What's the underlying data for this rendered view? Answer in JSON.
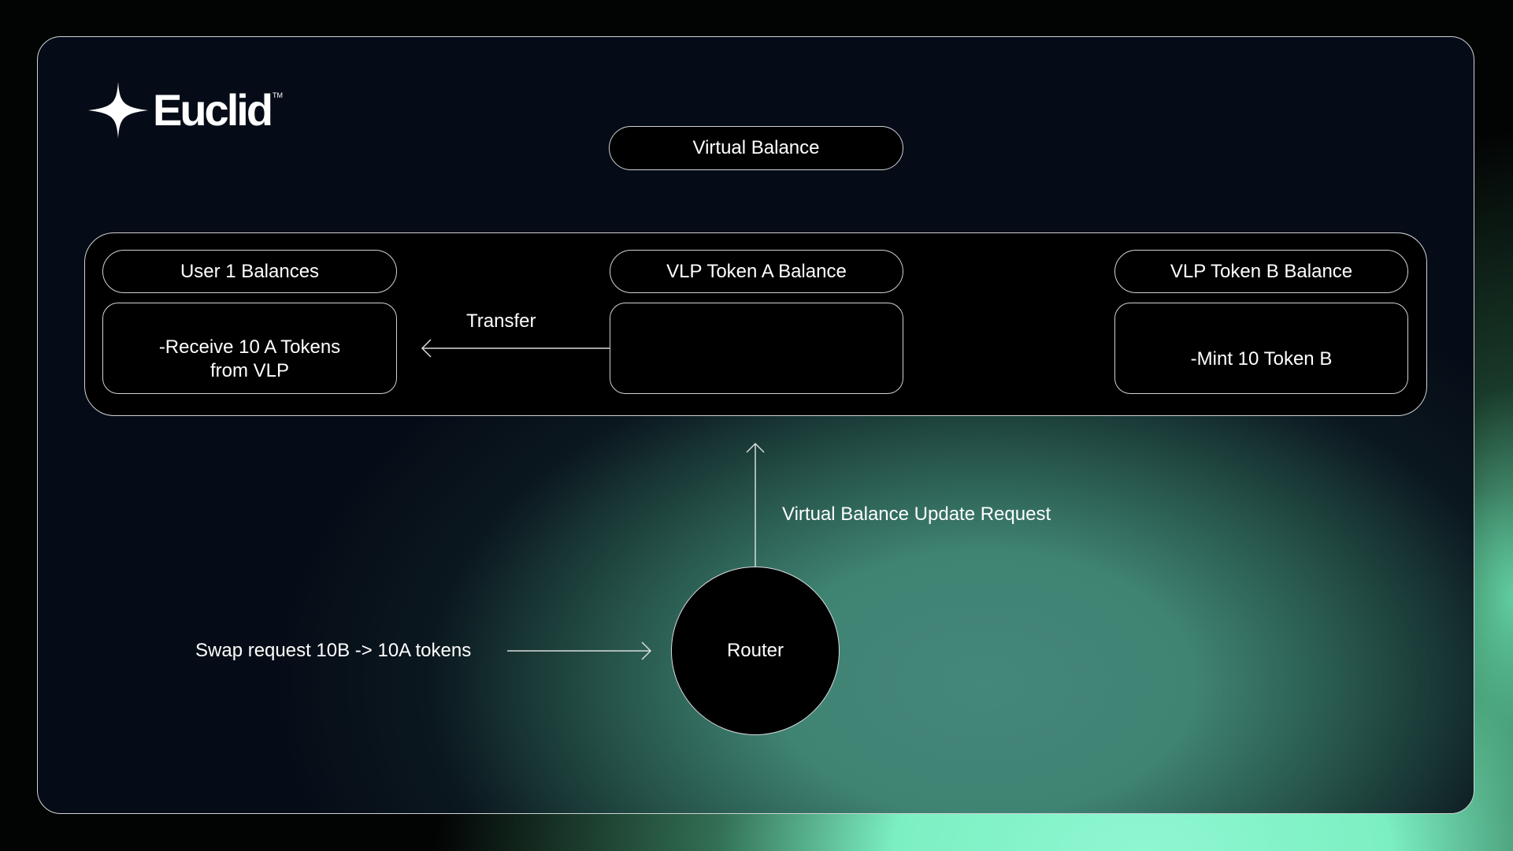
{
  "brand": {
    "name": "Euclid",
    "trademark": "TM",
    "icon": "four-point-star-icon"
  },
  "diagram": {
    "title_pill": "Virtual Balance",
    "columns": [
      {
        "header": "User 1 Balances",
        "body_line1": "-Receive 10 A Tokens",
        "body_line2": "from VLP"
      },
      {
        "header": "VLP Token A Balance",
        "body_line1": "",
        "body_line2": ""
      },
      {
        "header": "VLP Token B Balance",
        "body_line1": "-Mint 10 Token B",
        "body_line2": ""
      }
    ],
    "transfer_label": "Transfer",
    "update_request_label": "Virtual Balance Update Request",
    "router_label": "Router",
    "swap_request_label": "Swap request 10B -> 10A tokens"
  },
  "colors": {
    "frame_bg": "#060c17",
    "accent_green": "#7ff3c5",
    "teal": "#45847a",
    "stroke": "#cfd3d6"
  }
}
